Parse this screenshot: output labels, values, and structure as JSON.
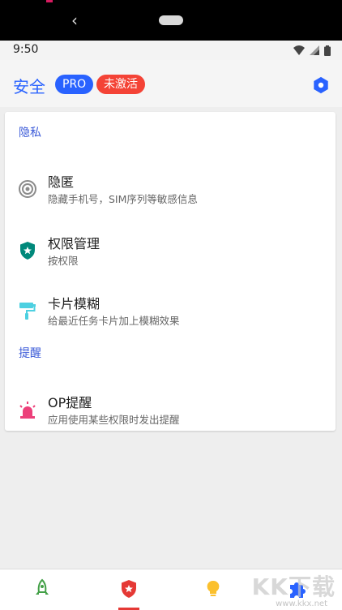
{
  "status_bar": {
    "time": "9:50"
  },
  "app_bar": {
    "title": "安全",
    "pro_badge": "PRO",
    "inactive_badge": "未激活"
  },
  "sections": {
    "privacy": {
      "header": "隐私",
      "items": [
        {
          "title": "隐匿",
          "subtitle": "隐藏手机号，SIM序列等敏感信息",
          "icon": "target-icon"
        },
        {
          "title": "权限管理",
          "subtitle": "按权限",
          "icon": "shield-star-icon"
        },
        {
          "title": "卡片模糊",
          "subtitle": "给最近任务卡片加上模糊效果",
          "icon": "paint-roller-icon"
        }
      ]
    },
    "reminder": {
      "header": "提醒",
      "items": [
        {
          "title": "OP提醒",
          "subtitle": "应用使用某些权限时发出提醒",
          "icon": "alarm-light-icon"
        }
      ]
    }
  },
  "bottom_nav": {
    "items": [
      "rocket-icon",
      "shield-star-icon",
      "lightbulb-icon",
      "puzzle-icon"
    ],
    "selected_index": 1
  },
  "watermark": {
    "text": "KK下载",
    "url": "www.kkx.net"
  },
  "colors": {
    "accent": "#2962ff",
    "danger": "#f44336",
    "teal": "#00897b",
    "cyan": "#4dd0e1",
    "pink": "#ec407a",
    "amber": "#fbc02d"
  }
}
